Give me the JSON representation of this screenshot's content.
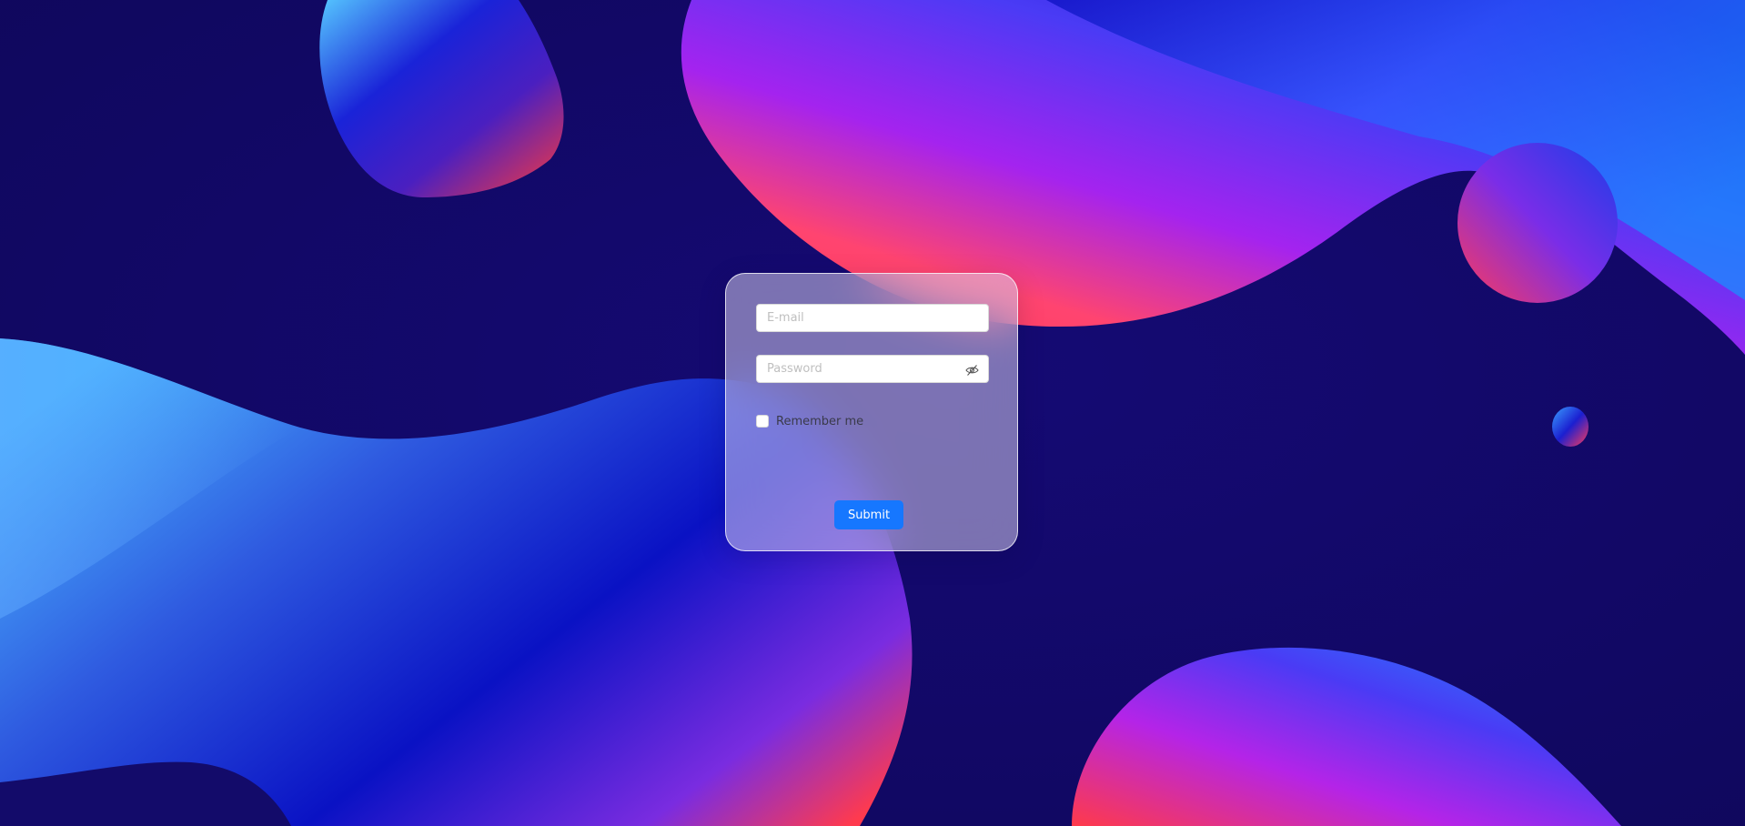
{
  "login_form": {
    "email_placeholder": "E-mail",
    "email_value": "",
    "password_placeholder": "Password",
    "password_value": "",
    "password_toggle_icon": "eye-invisible-icon",
    "remember_label": "Remember me",
    "remember_checked": false,
    "submit_label": "Submit"
  },
  "colors": {
    "background": "#110862",
    "primary_button": "#1677ff",
    "card_glass": "rgba(218,210,240,0.52)"
  }
}
